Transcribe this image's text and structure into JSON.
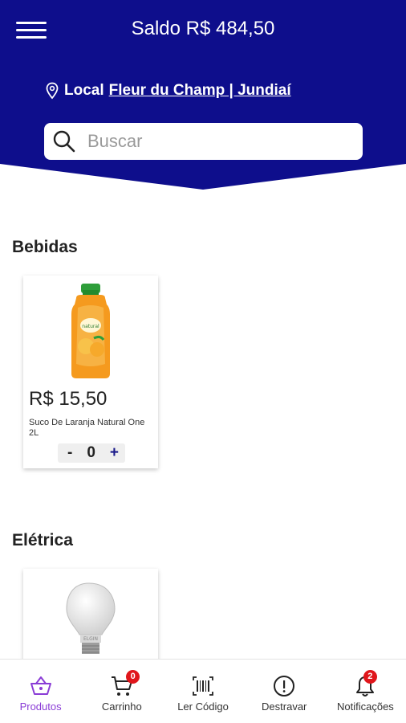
{
  "header": {
    "balance": "Saldo R$ 484,50",
    "location_label": "Local",
    "location_value": "Fleur du Champ | Jundiaí",
    "bg_color": "#0e0e8c"
  },
  "search": {
    "placeholder": "Buscar"
  },
  "categories": [
    {
      "title": "Bebidas",
      "products": [
        {
          "price": "R$ 15,50",
          "name": "Suco De Laranja Natural One 2L",
          "quantity": "0",
          "image": "orange-juice-bottle"
        }
      ]
    },
    {
      "title": "Elétrica",
      "products": [
        {
          "image": "light-bulb"
        }
      ]
    }
  ],
  "bottom_nav": [
    {
      "label": "Produtos",
      "icon": "basket-icon",
      "active": true
    },
    {
      "label": "Carrinho",
      "icon": "cart-icon",
      "badge": "0"
    },
    {
      "label": "Ler Código",
      "icon": "barcode-icon"
    },
    {
      "label": "Destravar",
      "icon": "alert-circle-icon"
    },
    {
      "label": "Notificações",
      "icon": "bell-icon",
      "badge": "2"
    }
  ],
  "colors": {
    "accent": "#8a3cd6",
    "badge": "#e0161b",
    "primary": "#0e0e8c"
  },
  "qty_controls": {
    "minus": "-",
    "plus": "+"
  }
}
